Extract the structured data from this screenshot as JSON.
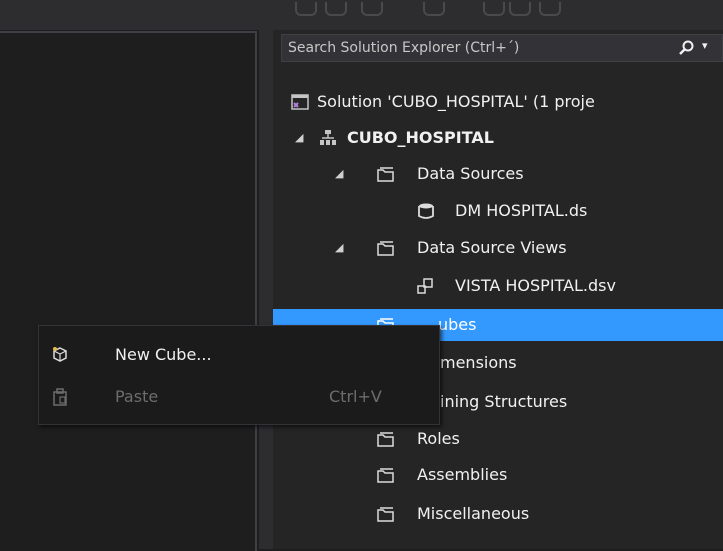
{
  "solution_explorer": {
    "search_placeholder": "Search Solution Explorer (Ctrl+´)",
    "tree": {
      "solution": "Solution 'CUBO_HOSPITAL' (1 proje",
      "project": "CUBO_HOSPITAL",
      "data_sources": "Data Sources",
      "ds_file": "DM HOSPITAL.ds",
      "data_source_views": "Data Source Views",
      "dsv_file": "VISTA HOSPITAL.dsv",
      "cubes_visible": "ubes",
      "dimensions_visible": "mensions",
      "mining_visible": "ining Structures",
      "roles": "Roles",
      "assemblies": "Assemblies",
      "misc": "Miscellaneous"
    }
  },
  "context_menu": {
    "items": [
      {
        "label": "New Cube...",
        "shortcut": "",
        "icon": "new-cube-icon",
        "enabled": true
      },
      {
        "label": "Paste",
        "shortcut": "Ctrl+V",
        "icon": "paste-icon",
        "enabled": false
      }
    ]
  },
  "colors": {
    "selection": "#3399ff",
    "background": "#1e1e1e",
    "panel": "#252526",
    "folder": "#dcdcdc"
  }
}
